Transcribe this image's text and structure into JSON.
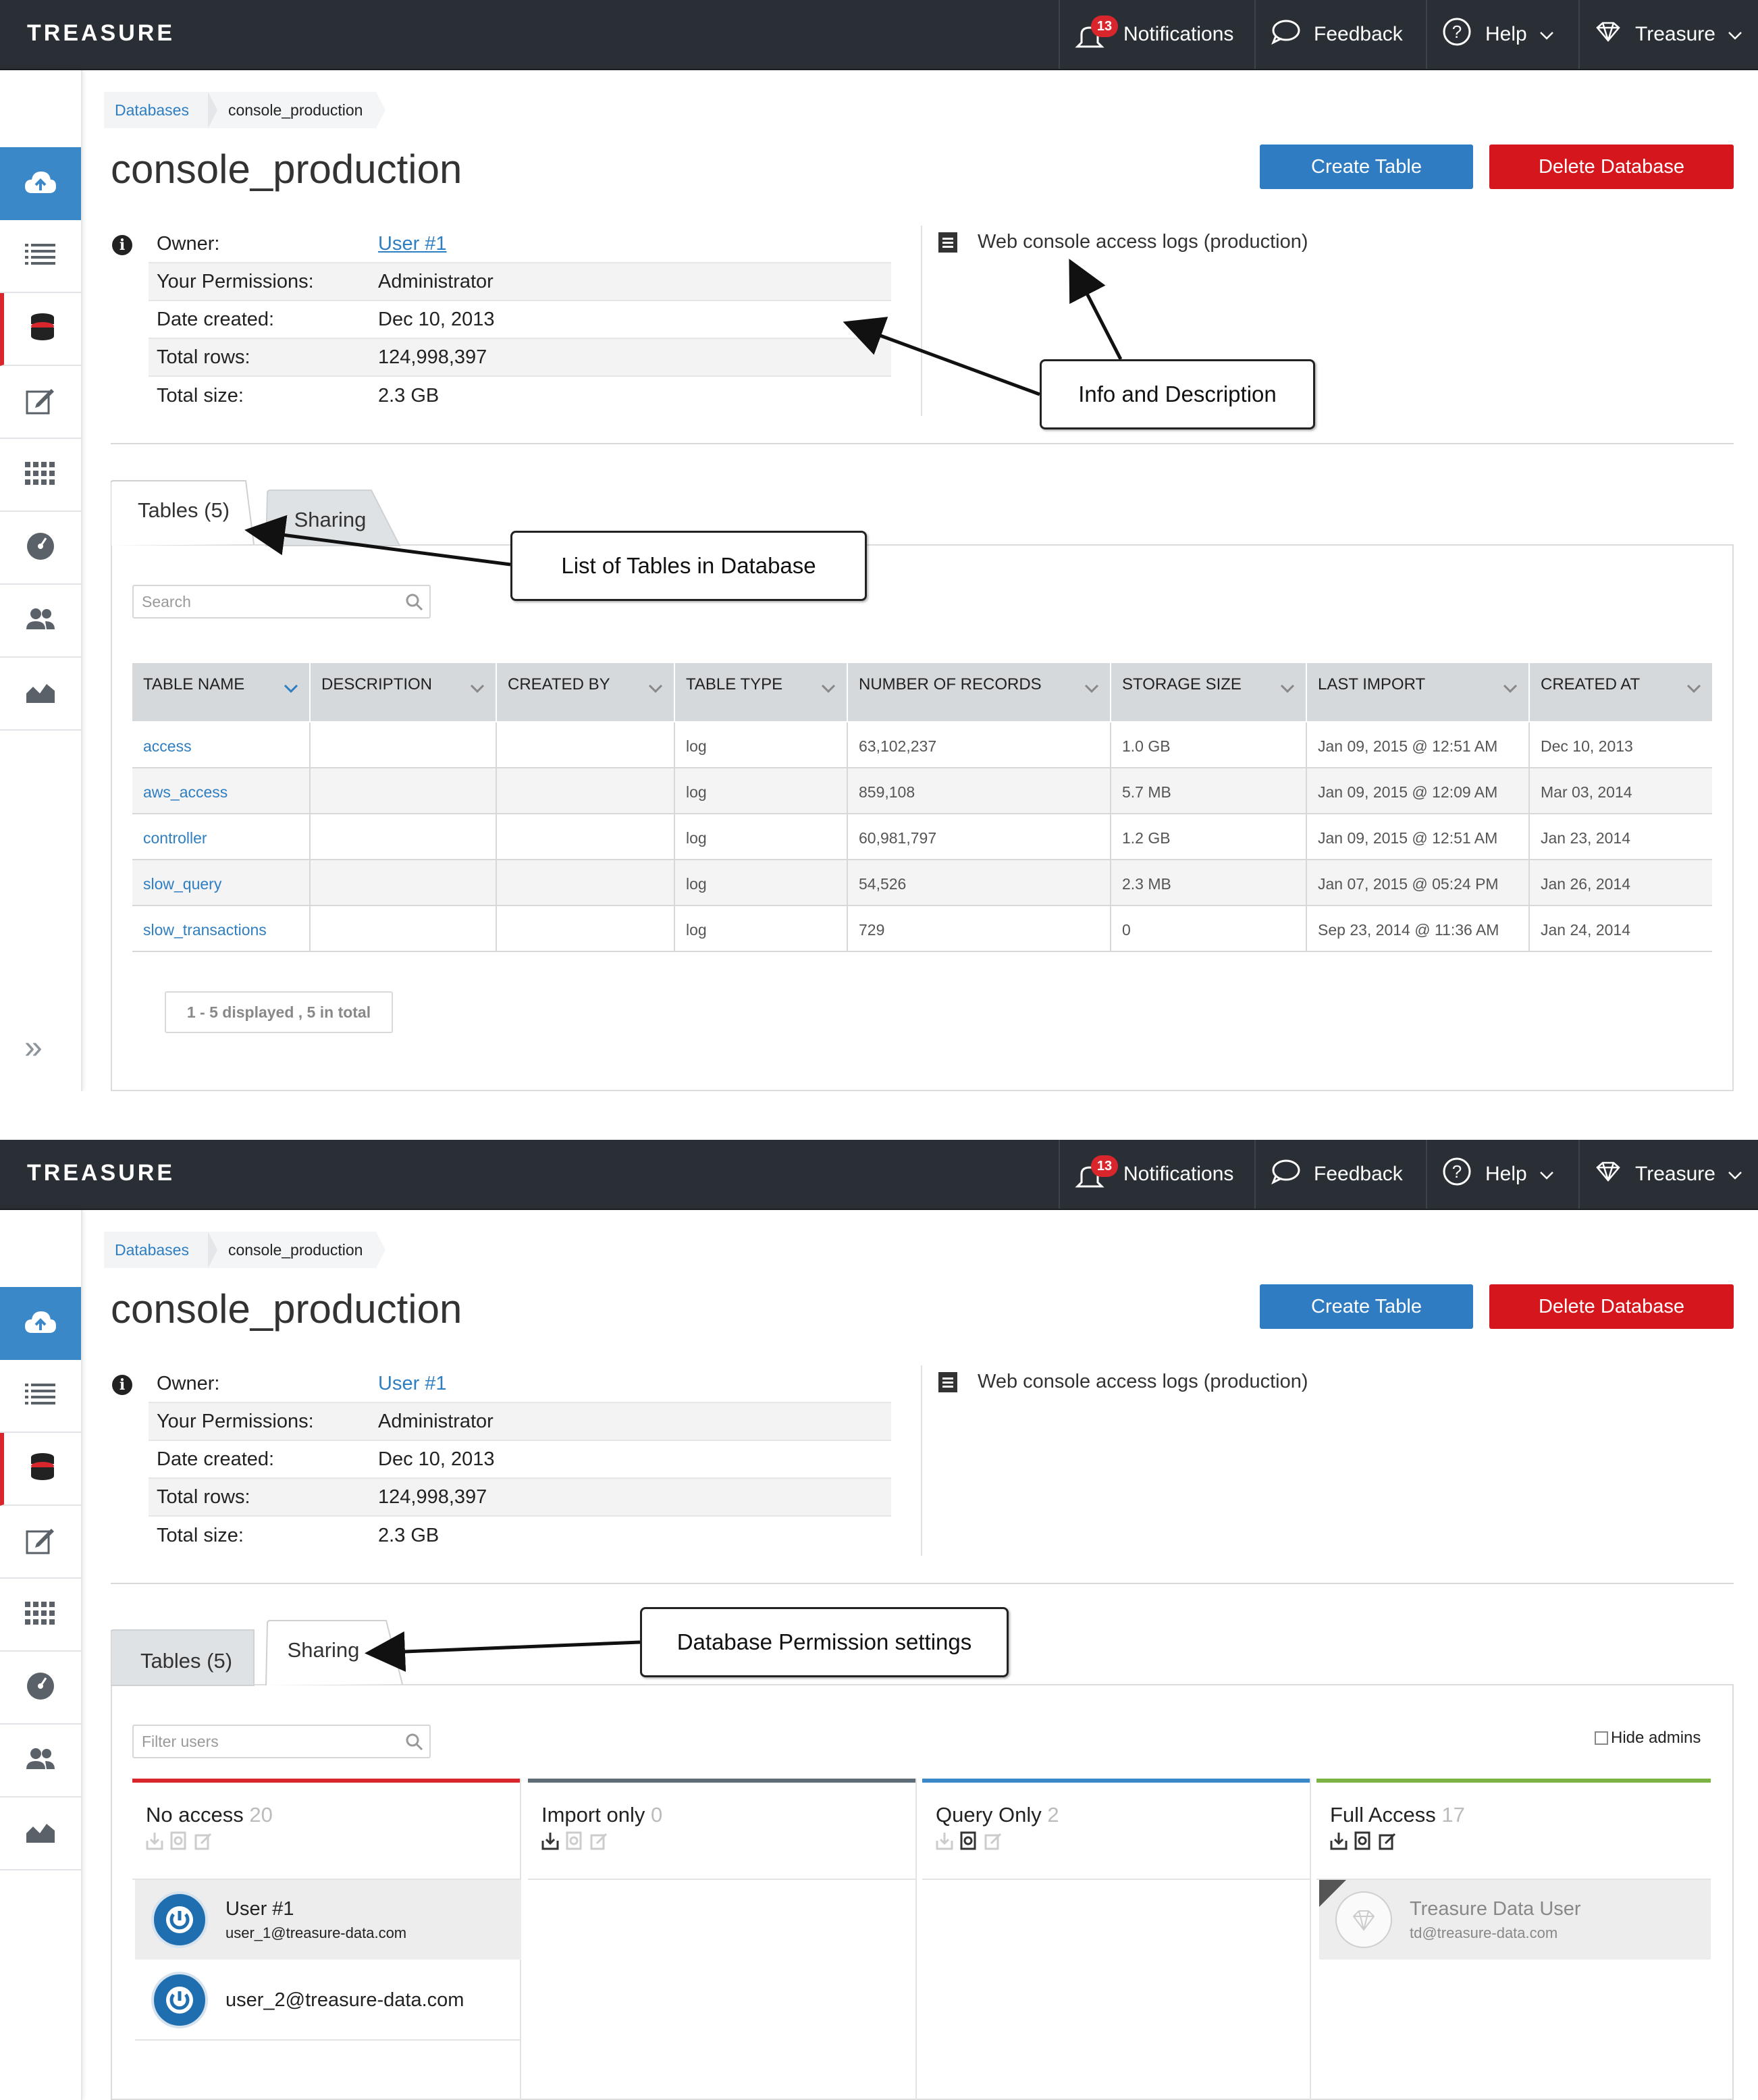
{
  "topbar": {
    "logo": "TREASURE",
    "notifications_badge": "13",
    "notifications_label": "Notifications",
    "feedback_label": "Feedback",
    "help_label": "Help",
    "user_label": "Treasure"
  },
  "breadcrumb": {
    "databases": "Databases",
    "current": "console_production"
  },
  "page": {
    "title": "console_production",
    "create_table": "Create Table",
    "delete_database": "Delete Database"
  },
  "info": {
    "owner_label": "Owner:",
    "owner_value": "User #1",
    "permissions_label": "Your Permissions:",
    "permissions_value": "Administrator",
    "created_label": "Date created:",
    "created_value": "Dec 10, 2013",
    "rows_label": "Total rows:",
    "rows_value": "124,998,397",
    "size_label": "Total size:",
    "size_value": "2.3 GB",
    "description": "Web console access logs (production)"
  },
  "tabs": {
    "tables": "Tables (5)",
    "sharing": "Sharing"
  },
  "tables": {
    "search_placeholder": "Search",
    "columns": [
      "TABLE NAME",
      "DESCRIPTION",
      "CREATED BY",
      "TABLE TYPE",
      "NUMBER OF RECORDS",
      "STORAGE SIZE",
      "LAST IMPORT",
      "CREATED AT"
    ],
    "rows": [
      [
        "access",
        "",
        "",
        "log",
        "63,102,237",
        "1.0 GB",
        "Jan 09, 2015 @ 12:51 AM",
        "Dec 10, 2013"
      ],
      [
        "aws_access",
        "",
        "",
        "log",
        "859,108",
        "5.7 MB",
        "Jan 09, 2015 @ 12:09 AM",
        "Mar 03, 2014"
      ],
      [
        "controller",
        "",
        "",
        "log",
        "60,981,797",
        "1.2 GB",
        "Jan 09, 2015 @ 12:51 AM",
        "Jan 23, 2014"
      ],
      [
        "slow_query",
        "",
        "",
        "log",
        "54,526",
        "2.3 MB",
        "Jan 07, 2015 @ 05:24 PM",
        "Jan 26, 2014"
      ],
      [
        "slow_transactions",
        "",
        "",
        "log",
        "729",
        "0",
        "Sep 23, 2014 @ 11:36 AM",
        "Jan 24, 2014"
      ]
    ],
    "pager": "1 - 5 displayed , 5 in total"
  },
  "sharing": {
    "filter_placeholder": "Filter users",
    "hide_admins": "Hide admins",
    "groups": [
      {
        "name": "No access",
        "count": "20",
        "color": "#d9262c"
      },
      {
        "name": "Import only",
        "count": "0",
        "color": "#5f6b77"
      },
      {
        "name": "Query Only",
        "count": "2",
        "color": "#3a88c8"
      },
      {
        "name": "Full Access",
        "count": "17",
        "color": "#7cb342"
      }
    ],
    "no_access_users": [
      {
        "name": "User #1",
        "email": "user_1@treasure-data.com"
      },
      {
        "name": "",
        "email": "user_2@treasure-data.com"
      }
    ],
    "full_access_users": [
      {
        "name": "Treasure Data User",
        "email": "td@treasure-data.com"
      }
    ]
  },
  "callouts": {
    "info": "Info and Description",
    "tables": "List of Tables in Database",
    "sharing": "Database Permission settings"
  },
  "colors": {
    "topbar": "#2a2f35",
    "accent_blue": "#2f7cc3",
    "danger_red": "#d5161c",
    "link": "#2e7ec2"
  }
}
